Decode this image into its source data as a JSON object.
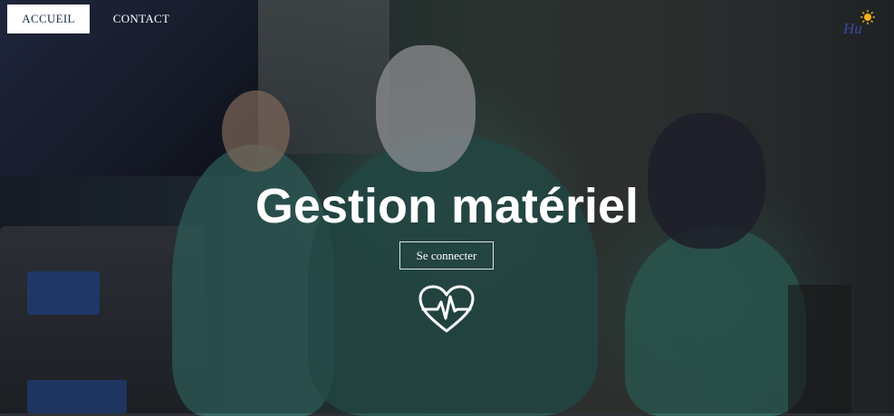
{
  "nav": {
    "items": [
      {
        "label": "ACCUEIL",
        "active": true
      },
      {
        "label": "CONTACT",
        "active": false
      }
    ]
  },
  "logo": {
    "text": "Hu",
    "icon": "sun-icon"
  },
  "hero": {
    "title": "Gestion matériel",
    "login_label": "Se connecter",
    "icon": "heartbeat-icon"
  },
  "colors": {
    "accent_text": "#1a2a4a",
    "logo_blue": "#3a4aa0",
    "logo_sun": "#f2b21a"
  }
}
